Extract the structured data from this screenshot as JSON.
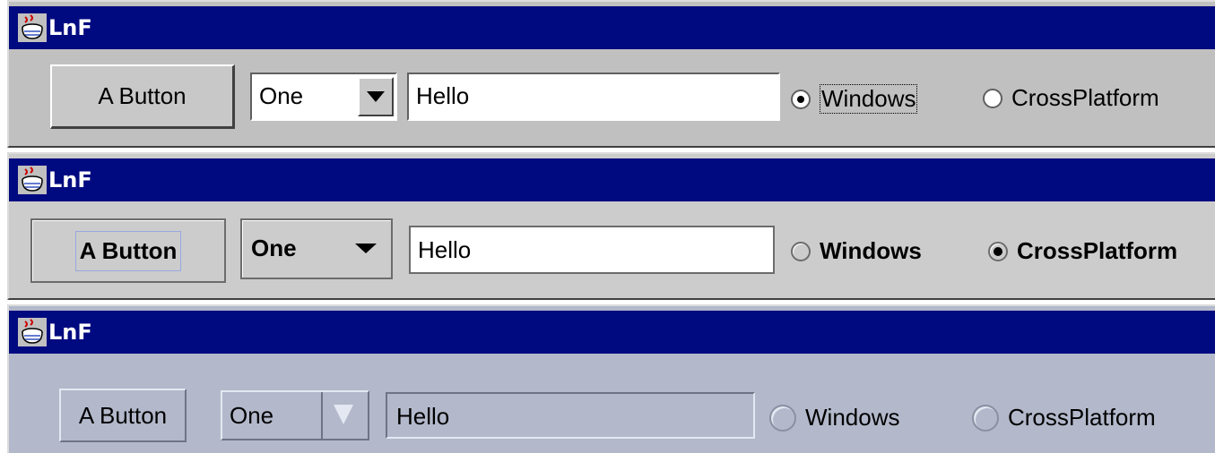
{
  "windows": [
    {
      "lnf": "Windows",
      "title": "LnF",
      "button_label": "A Button",
      "combo": {
        "selected": "One"
      },
      "text_field": {
        "value": "Hello"
      },
      "radios": [
        {
          "label": "Windows",
          "selected": true
        },
        {
          "label": "CrossPlatform",
          "selected": false
        }
      ]
    },
    {
      "lnf": "CrossPlatform",
      "title": "LnF",
      "button_label": "A Button",
      "combo": {
        "selected": "One"
      },
      "text_field": {
        "value": "Hello"
      },
      "radios": [
        {
          "label": "Windows",
          "selected": false
        },
        {
          "label": "CrossPlatform",
          "selected": true
        }
      ]
    },
    {
      "lnf": "Motif",
      "title": "LnF",
      "button_label": "A Button",
      "combo": {
        "selected": "One"
      },
      "text_field": {
        "value": "Hello"
      },
      "radios": [
        {
          "label": "Windows",
          "selected": false
        },
        {
          "label": "CrossPlatform",
          "selected": false
        }
      ]
    }
  ],
  "colors": {
    "titlebar": "#000a80",
    "windows_bg": "#c0c0c0",
    "metal_bg": "#cccccc",
    "motif_bg": "#b3b9cb"
  },
  "icons": {
    "window_icon": "java-coffee-cup-icon"
  }
}
